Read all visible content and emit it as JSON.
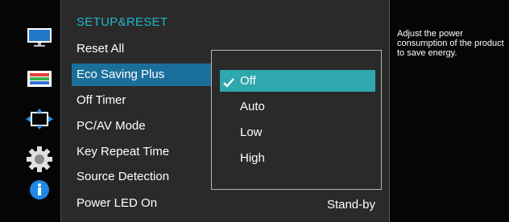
{
  "menu": {
    "title": "SETUP&RESET",
    "items": [
      {
        "label": "Reset All"
      },
      {
        "label": "Eco Saving Plus",
        "selected": true
      },
      {
        "label": "Off Timer"
      },
      {
        "label": "PC/AV Mode"
      },
      {
        "label": "Key Repeat Time"
      },
      {
        "label": "Source Detection"
      },
      {
        "label": "Power LED On"
      }
    ],
    "power_led_value": "Stand-by"
  },
  "dropdown": {
    "options": [
      {
        "label": "Off",
        "selected": true
      },
      {
        "label": "Auto"
      },
      {
        "label": "Low"
      },
      {
        "label": "High"
      }
    ]
  },
  "help": {
    "text": "Adjust the power consumption of the product to save energy."
  },
  "sidebar": {
    "icons": [
      "monitor-icon",
      "color-palette-icon",
      "screen-size-icon",
      "gear-icon",
      "info-icon"
    ]
  },
  "colors": {
    "accent_title": "#22b9cc",
    "selected_item": "#1b6f9b",
    "selected_option": "#2ea7ad",
    "panel_bg": "#2a2a2a",
    "sidebar_bg": "#050505"
  }
}
